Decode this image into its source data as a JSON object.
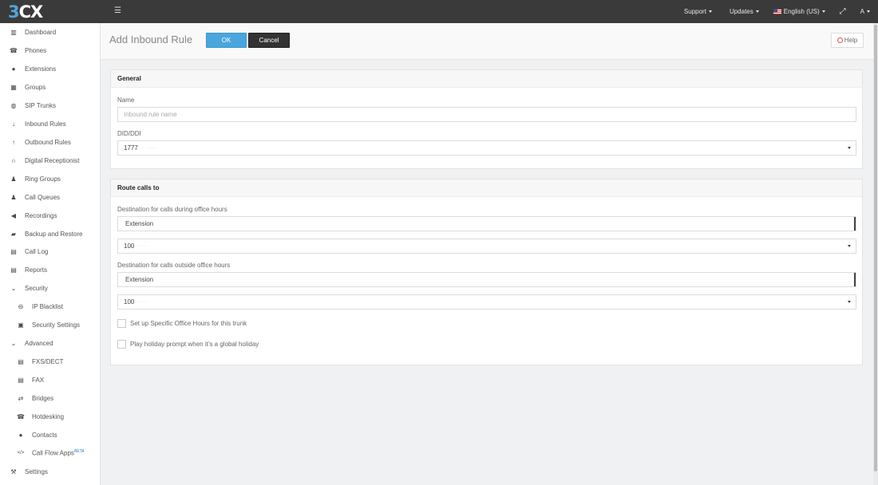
{
  "logo": {
    "digit": "3",
    "letters": "CX"
  },
  "topbar": {
    "support_label": "Support",
    "updates_label": "Updates",
    "language_label": "English (US)",
    "user_label": "A"
  },
  "sidebar": {
    "items": [
      {
        "label": "Dashboard",
        "icon": "bar-chart-icon",
        "glyph": "▥"
      },
      {
        "label": "Phones",
        "icon": "phone-icon",
        "glyph": "☎"
      },
      {
        "label": "Extensions",
        "icon": "user-icon",
        "glyph": "●"
      },
      {
        "label": "Groups",
        "icon": "grid-icon",
        "glyph": "▦"
      },
      {
        "label": "SIP Trunks",
        "icon": "globe-icon",
        "glyph": "◍"
      },
      {
        "label": "Inbound Rules",
        "icon": "arrow-down-icon",
        "glyph": "↓"
      },
      {
        "label": "Outbound Rules",
        "icon": "arrow-up-icon",
        "glyph": "↑"
      },
      {
        "label": "Digital Receptionist",
        "icon": "headset-icon",
        "glyph": "∩"
      },
      {
        "label": "Ring Groups",
        "icon": "users-icon",
        "glyph": "♟"
      },
      {
        "label": "Call Queues",
        "icon": "users-icon",
        "glyph": "♟"
      },
      {
        "label": "Recordings",
        "icon": "speaker-icon",
        "glyph": "◀"
      },
      {
        "label": "Backup and Restore",
        "icon": "folder-icon",
        "glyph": "▰"
      },
      {
        "label": "Call Log",
        "icon": "document-icon",
        "glyph": "▤"
      },
      {
        "label": "Reports",
        "icon": "document-icon",
        "glyph": "▤"
      },
      {
        "label": "Security",
        "icon": "chevron-down-icon",
        "glyph": "⌄"
      },
      {
        "label": "IP Blacklist",
        "icon": "minus-circle-icon",
        "glyph": "⊖"
      },
      {
        "label": "Security Settings",
        "icon": "lock-icon",
        "glyph": "▣"
      },
      {
        "label": "Advanced",
        "icon": "chevron-down-icon",
        "glyph": "⌄"
      },
      {
        "label": "FXS/DECT",
        "icon": "fax-icon",
        "glyph": "▤"
      },
      {
        "label": "FAX",
        "icon": "fax-icon",
        "glyph": "▤"
      },
      {
        "label": "Bridges",
        "icon": "exchange-icon",
        "glyph": "⇄"
      },
      {
        "label": "Hotdesking",
        "icon": "phone-icon",
        "glyph": "☎"
      },
      {
        "label": "Contacts",
        "icon": "user-icon",
        "glyph": "●"
      },
      {
        "label": "Call Flow Apps",
        "icon": "code-icon",
        "glyph": "</>",
        "badge": "BETA"
      },
      {
        "label": "Settings",
        "icon": "wrench-icon",
        "glyph": "⚒"
      }
    ]
  },
  "page": {
    "title": "Add Inbound Rule",
    "ok_label": "OK",
    "cancel_label": "Cancel",
    "help_label": "Help"
  },
  "general": {
    "heading": "General",
    "name_label": "Name",
    "name_placeholder": "Inbound rule name",
    "did_label": "DID/DDI",
    "did_value": "1777"
  },
  "route": {
    "heading": "Route calls to",
    "office_label": "Destination for calls during office hours",
    "office_type": "Extension",
    "office_ext": "100",
    "outside_label": "Destination for calls outside office hours",
    "outside_type": "Extension",
    "outside_ext": "100",
    "office_hours_checkbox": "Set up Specific Office Hours for this trunk",
    "holiday_checkbox": "Play holiday prompt when it’s a global holiday"
  }
}
